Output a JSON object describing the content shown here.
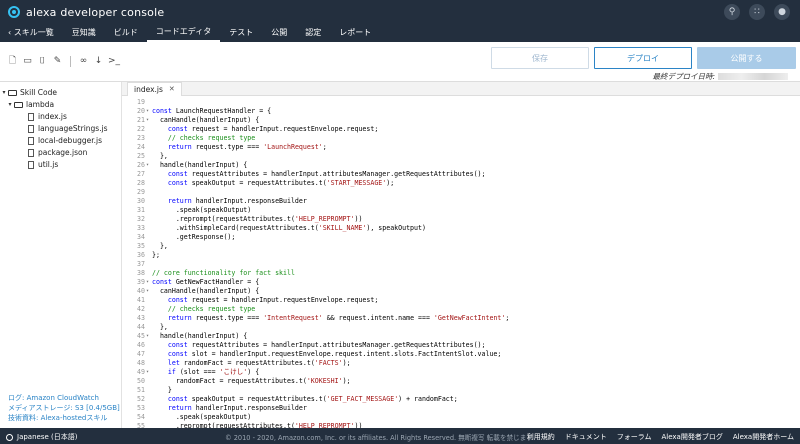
{
  "app": {
    "title": "alexa developer console"
  },
  "top_icons": [
    "search-icon",
    "apps-icon",
    "user-icon"
  ],
  "nav": {
    "back_label": "スキル一覧",
    "items": [
      "豆知識",
      "ビルド",
      "コードエディタ",
      "テスト",
      "公開",
      "認定",
      "レポート"
    ],
    "active": "コードエディタ"
  },
  "toolbar": {
    "save_label": "保存",
    "deploy_label": "デプロイ",
    "publish_label": "公開する",
    "last_deploy_label": "最終デプロイ日時:"
  },
  "sidebar": {
    "root": "Skill Code",
    "folder": "lambda",
    "files": [
      "index.js",
      "languageStrings.js",
      "local-debugger.js",
      "package.json",
      "util.js"
    ],
    "links": [
      {
        "label": "ログ: ",
        "link": "Amazon CloudWatch"
      },
      {
        "label": "メディアストレージ: ",
        "link": "S3 [0.4/5GB]"
      },
      {
        "label": "技術資料: ",
        "link": "Alexa-hostedスキル"
      }
    ]
  },
  "editor": {
    "tab": "index.js",
    "lines": [
      {
        "n": "19",
        "f": "",
        "t": ""
      },
      {
        "n": "20",
        "f": "▾",
        "t": "<k>const</k> LaunchRequestHandler = {"
      },
      {
        "n": "21",
        "f": "▾",
        "t": "  canHandle(handlerInput) {"
      },
      {
        "n": "22",
        "f": "",
        "t": "    <k>const</k> request = handlerInput.requestEnvelope.request;"
      },
      {
        "n": "23",
        "f": "",
        "t": "    <c>// checks request type</c>"
      },
      {
        "n": "24",
        "f": "",
        "t": "    <k>return</k> request.type === <s>'LaunchRequest'</s>;"
      },
      {
        "n": "25",
        "f": "",
        "t": "  },"
      },
      {
        "n": "26",
        "f": "▾",
        "t": "  handle(handlerInput) {"
      },
      {
        "n": "27",
        "f": "",
        "t": "    <k>const</k> requestAttributes = handlerInput.attributesManager.getRequestAttributes();"
      },
      {
        "n": "28",
        "f": "",
        "t": "    <k>const</k> speakOutput = requestAttributes.t(<s>'START_MESSAGE'</s>);"
      },
      {
        "n": "29",
        "f": "",
        "t": ""
      },
      {
        "n": "30",
        "f": "",
        "t": "    <k>return</k> handlerInput.responseBuilder"
      },
      {
        "n": "31",
        "f": "",
        "t": "      .speak(speakOutput)"
      },
      {
        "n": "32",
        "f": "",
        "t": "      .reprompt(requestAttributes.t(<s>'HELP_REPROMPT'</s>))"
      },
      {
        "n": "33",
        "f": "",
        "t": "      .withSimpleCard(requestAttributes.t(<s>'SKILL_NAME'</s>), speakOutput)"
      },
      {
        "n": "34",
        "f": "",
        "t": "      .getResponse();"
      },
      {
        "n": "35",
        "f": "",
        "t": "  },"
      },
      {
        "n": "36",
        "f": "",
        "t": "};"
      },
      {
        "n": "37",
        "f": "",
        "t": ""
      },
      {
        "n": "38",
        "f": "",
        "t": "<c>// core functionality for fact skill</c>"
      },
      {
        "n": "39",
        "f": "▾",
        "t": "<k>const</k> GetNewFactHandler = {"
      },
      {
        "n": "40",
        "f": "▾",
        "t": "  canHandle(handlerInput) {"
      },
      {
        "n": "41",
        "f": "",
        "t": "    <k>const</k> request = handlerInput.requestEnvelope.request;"
      },
      {
        "n": "42",
        "f": "",
        "t": "    <c>// checks request type</c>"
      },
      {
        "n": "43",
        "f": "",
        "t": "    <k>return</k> request.type === <s>'IntentRequest'</s> && request.intent.name === <s>'GetNewFactIntent'</s>;"
      },
      {
        "n": "44",
        "f": "",
        "t": "  },"
      },
      {
        "n": "45",
        "f": "▾",
        "t": "  handle(handlerInput) {"
      },
      {
        "n": "46",
        "f": "",
        "t": "    <k>const</k> requestAttributes = handlerInput.attributesManager.getRequestAttributes();"
      },
      {
        "n": "47",
        "f": "",
        "t": "    <k>const</k> slot = handlerInput.requestEnvelope.request.intent.slots.FactIntentSlot.value;"
      },
      {
        "n": "48",
        "f": "",
        "t": "    <k>let</k> randomFact = requestAttributes.t(<s>'FACTS'</s>);"
      },
      {
        "n": "49",
        "f": "▾",
        "t": "    <k>if</k> (slot === <s>'こけし'</s>) {"
      },
      {
        "n": "50",
        "f": "",
        "t": "      randomFact = requestAttributes.t(<s>'KOKESHI'</s>);"
      },
      {
        "n": "51",
        "f": "",
        "t": "    }"
      },
      {
        "n": "52",
        "f": "",
        "t": "    <k>const</k> speakOutput = requestAttributes.t(<s>'GET_FACT_MESSAGE'</s>) + randomFact;"
      },
      {
        "n": "53",
        "f": "",
        "t": "    <k>return</k> handlerInput.responseBuilder"
      },
      {
        "n": "54",
        "f": "",
        "t": "      .speak(speakOutput)"
      },
      {
        "n": "55",
        "f": "",
        "t": "      .reprompt(requestAttributes.t(<s>'HELP_REPROMPT'</s>))"
      }
    ]
  },
  "footer": {
    "language": "Japanese (日本語)",
    "copyright": "© 2010 - 2020, Amazon.com, Inc. or its affiliates. All Rights Reserved. 無断複写 転載を禁じます",
    "links": [
      "利用規約",
      "ドキュメント",
      "フォーラム",
      "Alexa開発者ブログ",
      "Alexa開発者ホーム"
    ]
  }
}
